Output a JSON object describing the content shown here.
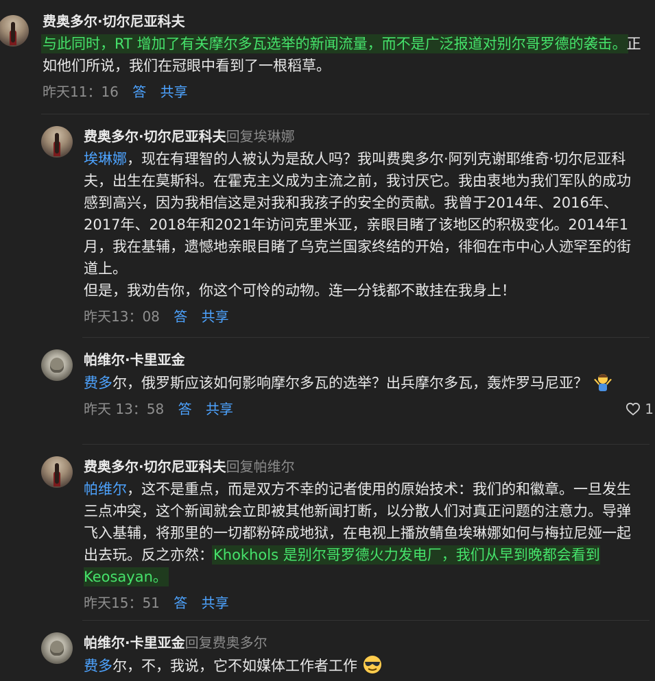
{
  "comments": [
    {
      "author": "费奥多尔·切尔尼亚科夫",
      "reply_label": "",
      "highlight": "与此同时，RT 增加了有关摩尔多瓦选举的新闻流量，而不是广泛报道对别尔哥罗德的袭击。",
      "text": "正如他们所说，我们在冠眼中看到了一根稻草。",
      "time": "昨天11：16",
      "reply_action": "答",
      "share_action": "共享"
    },
    {
      "author": "费奥多尔·切尔尼亚科夫",
      "reply_label": "回复埃琳娜",
      "mention": "埃琳娜",
      "text": "，现在有理智的人被认为是敌人吗？我叫费奥多尔·阿列克谢耶维奇·切尔尼亚科夫，出生在莫斯科。在霍克主义成为主流之前，我讨厌它。我由衷地为我们军队的成功感到高兴，因为我相信这是对我和我孩子的安全的贡献。我曾于2014年、2016年、2017年、2018年和2021年访问克里米亚，亲眼目睹了该地区的积极变化。2014年1月，我在基辅，遗憾地亲眼目睹了乌克兰国家终结的开始，徘徊在市中心人迹罕至的街道上。",
      "text2": "但是，我劝告你，你这个可怜的动物。连一分钱都不敢挂在我身上！",
      "time": "昨天13：08",
      "reply_action": "答",
      "share_action": "共享"
    },
    {
      "author": "帕维尔·卡里亚金",
      "reply_label": "",
      "mention": "费多",
      "text": "尔，俄罗斯应该如何影响摩尔多瓦的选举？出兵摩尔多瓦，轰炸罗马尼亚？",
      "emoji": "person-shrugging-emoji",
      "time": "昨天 13：58",
      "reply_action": "答",
      "share_action": "共享",
      "likes": "1"
    },
    {
      "author": "费奥多尔·切尔尼亚科夫",
      "reply_label": "回复帕维尔",
      "mention": "帕维尔",
      "text": "，这不是重点，而是双方不幸的记者使用的原始技术：我们的和徽章。一旦发生三点冲突，这个新闻就会立即被其他新闻打断，以分散人们对真正问题的注意力。导弹飞入基辅，将那里的一切都粉碎成地狱，在电视上播放鲭鱼埃琳娜如何与梅拉尼娅一起出去玩。反之亦然：",
      "highlight": "Khokhols 是别尔哥罗德火力发电厂，我们从早到晚都会看到 Keosayan。",
      "time": "昨天15：51",
      "reply_action": "答",
      "share_action": "共享"
    },
    {
      "author": "帕维尔·卡里亚金",
      "reply_label": "回复费奥多尔",
      "mention": "费多",
      "text": "尔，不，我说，它不如媒体工作者工作",
      "emoji": "smiling-face-with-sunglasses-emoji"
    }
  ],
  "colors": {
    "background": "#212121",
    "mention": "#4da3ff",
    "highlight_text": "#46e36b",
    "muted": "#8f8f8f"
  }
}
